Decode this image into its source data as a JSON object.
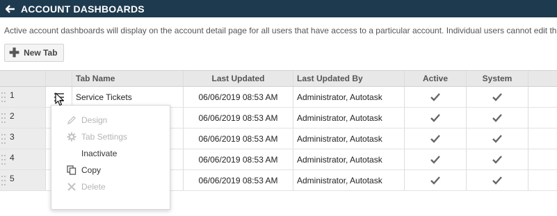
{
  "header": {
    "title": "ACCOUNT DASHBOARDS",
    "back_icon": "back-arrow-icon"
  },
  "description": "Active account dashboards will display on the account detail page for all users that have access to a particular account. Individual users cannot edit th",
  "toolbar": {
    "new_tab_label": "New Tab",
    "new_tab_icon": "plus-icon"
  },
  "table": {
    "columns": {
      "tab_name": "Tab Name",
      "last_updated": "Last Updated",
      "last_updated_by": "Last Updated By",
      "active": "Active",
      "system": "System"
    },
    "rows": [
      {
        "num": "1",
        "name": "Service Tickets",
        "updated": "06/06/2019 08:53 AM",
        "by": "Administrator, Autotask",
        "active": true,
        "system": true
      },
      {
        "num": "2",
        "name": "",
        "updated": "06/06/2019 08:53 AM",
        "by": "Administrator, Autotask",
        "active": true,
        "system": true
      },
      {
        "num": "3",
        "name": "",
        "updated": "06/06/2019 08:53 AM",
        "by": "Administrator, Autotask",
        "active": true,
        "system": true
      },
      {
        "num": "4",
        "name": "",
        "updated": "06/06/2019 08:53 AM",
        "by": "Administrator, Autotask",
        "active": true,
        "system": true
      },
      {
        "num": "5",
        "name": "",
        "updated": "06/06/2019 08:53 AM",
        "by": "Administrator, Autotask",
        "active": true,
        "system": true
      }
    ]
  },
  "context_menu": {
    "items": [
      {
        "label": "Design",
        "icon": "pencil-icon",
        "enabled": false
      },
      {
        "label": "Tab Settings",
        "icon": "gear-icon",
        "enabled": false
      },
      {
        "label": "Inactivate",
        "icon": "",
        "enabled": true
      },
      {
        "label": "Copy",
        "icon": "copy-icon",
        "enabled": true
      },
      {
        "label": "Delete",
        "icon": "x-icon",
        "enabled": false
      }
    ]
  },
  "colors": {
    "title_bar": "#1e3a4f",
    "disabled_text": "#b5b5b5",
    "header_bg": "#e8e8e8"
  }
}
